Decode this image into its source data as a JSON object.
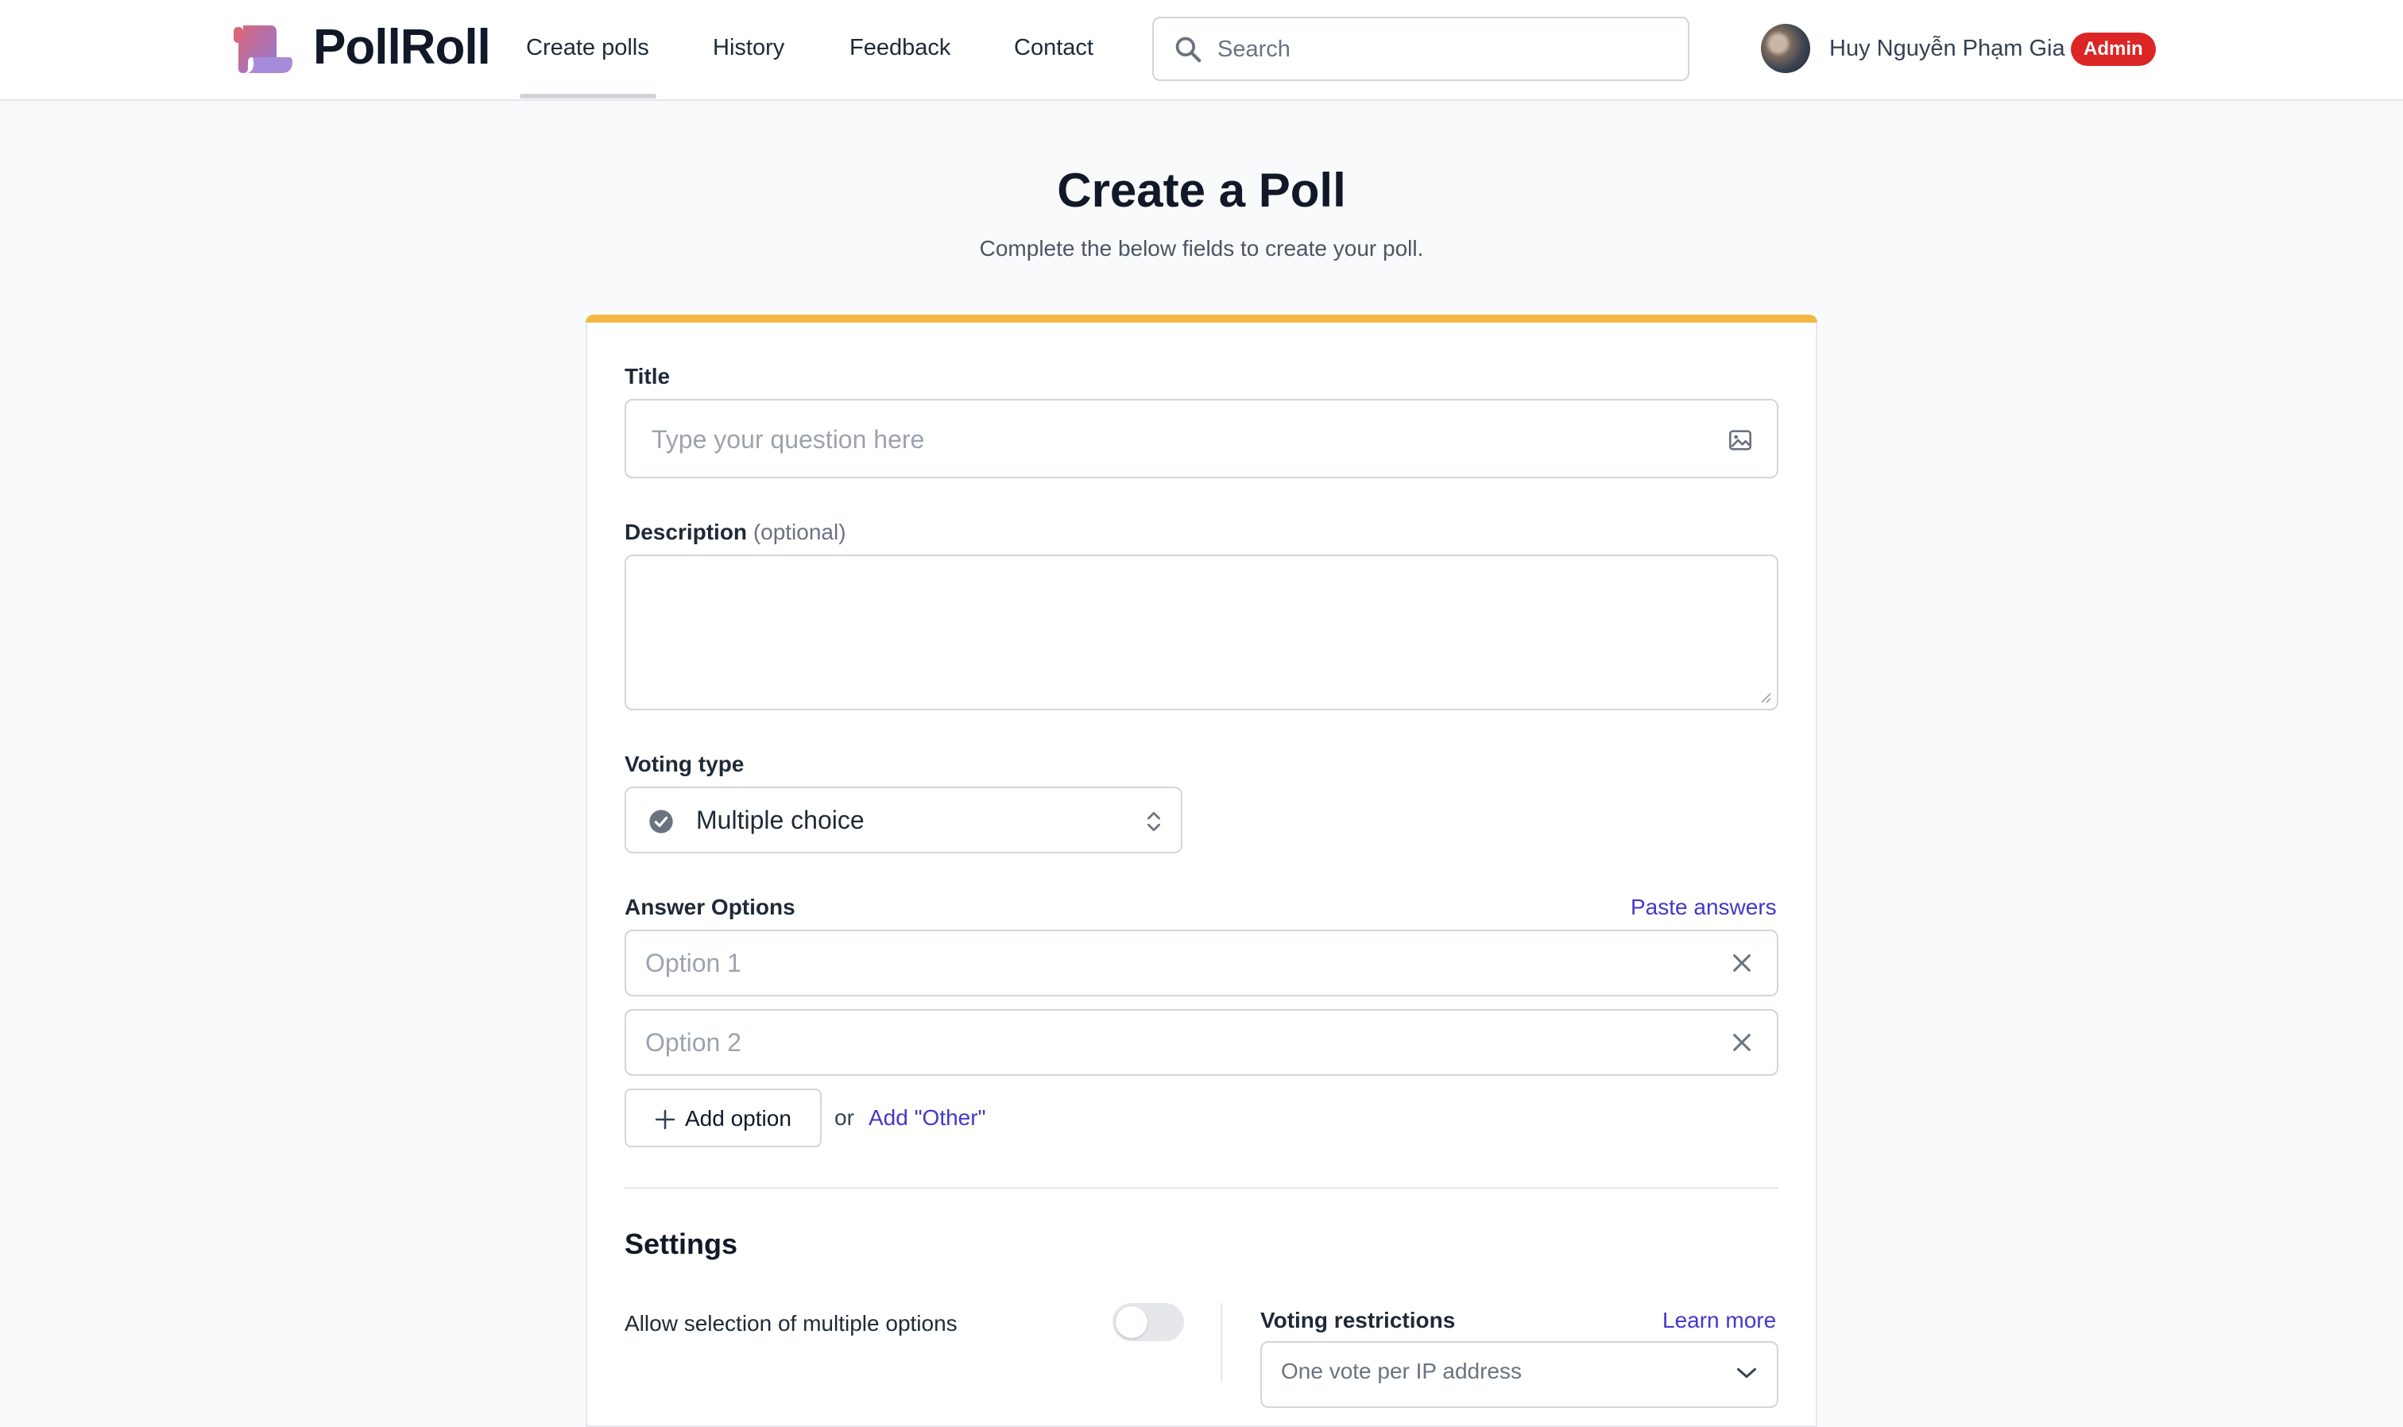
{
  "header": {
    "brand": "PollRoll",
    "nav": [
      {
        "label": "Create polls",
        "active": true
      },
      {
        "label": "History"
      },
      {
        "label": "Feedback"
      },
      {
        "label": "Contact"
      }
    ],
    "search": {
      "placeholder": "Search",
      "value": ""
    },
    "user": {
      "name": "Huy Nguyễn Phạm Gia",
      "role_badge": "Admin"
    }
  },
  "page": {
    "title": "Create a Poll",
    "subtitle": "Complete the below fields to create your poll."
  },
  "form": {
    "title": {
      "label": "Title",
      "placeholder": "Type your question here",
      "value": ""
    },
    "description": {
      "label": "Description",
      "optional_hint": "(optional)",
      "value": ""
    },
    "voting_type": {
      "label": "Voting type",
      "value": "Multiple choice"
    },
    "answer_options": {
      "label": "Answer Options",
      "paste_link": "Paste answers",
      "options": [
        {
          "placeholder": "Option 1",
          "value": ""
        },
        {
          "placeholder": "Option 2",
          "value": ""
        }
      ],
      "add_option_label": "Add option",
      "or_text": "or",
      "add_other_link": "Add \"Other\""
    },
    "settings": {
      "title": "Settings",
      "allow_multiple": {
        "label": "Allow selection of multiple options",
        "enabled": false
      },
      "voting_restrictions": {
        "label": "Voting restrictions",
        "learn_more": "Learn more",
        "value": "One vote per IP address"
      }
    }
  },
  "colors": {
    "accent": "#4338ca",
    "card_top_border": "#f2b843",
    "admin_badge": "#dc2626"
  }
}
